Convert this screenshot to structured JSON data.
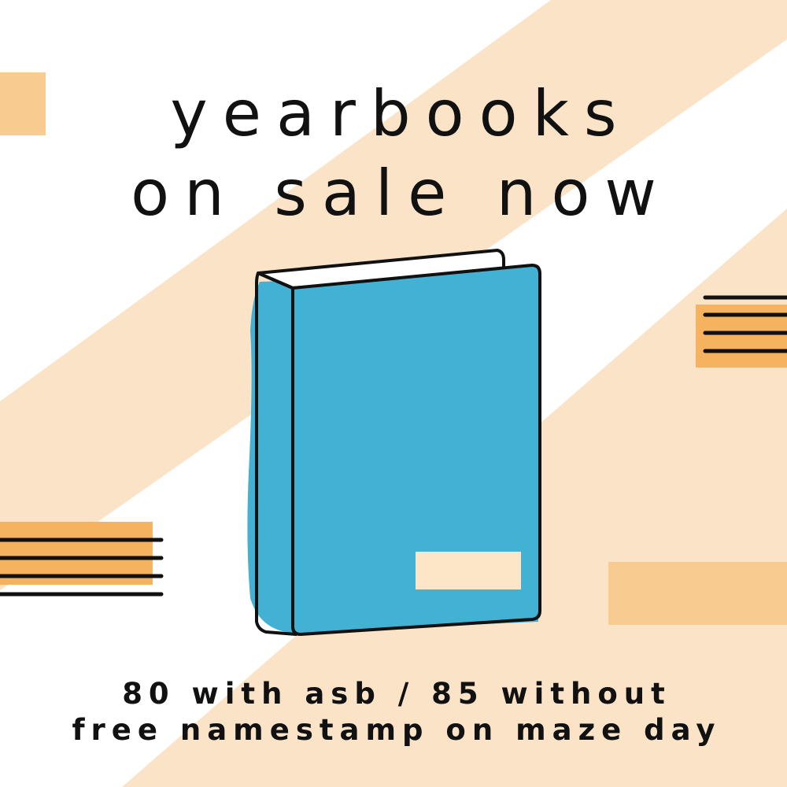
{
  "colors": {
    "background_peach": "#fbe3c7",
    "stripe_white": "#ffffff",
    "accent_orange": "#f5b25f",
    "light_orange": "#f8cc90",
    "book_blue": "#43b1d3",
    "label_cream": "#fde6c8",
    "ink": "#111111"
  },
  "headline": {
    "line1": "yearbooks",
    "line2": "on sale now"
  },
  "details": {
    "price_line": "80 with asb / 85 without",
    "promo_line": "free namestamp on maze day"
  },
  "illustration": {
    "subject": "book-icon",
    "decorations": [
      "striped-bar-icon",
      "orange-block"
    ]
  }
}
